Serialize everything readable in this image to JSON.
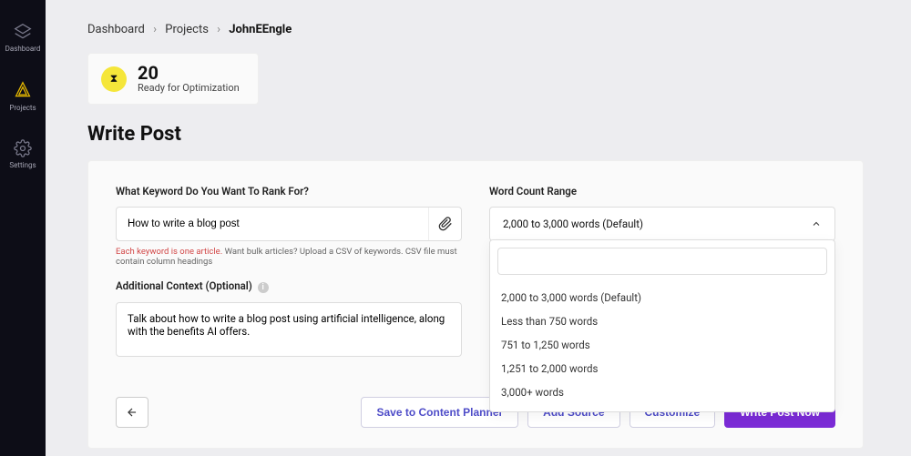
{
  "sidebar": {
    "items": [
      {
        "label": "Dashboard"
      },
      {
        "label": "Projects"
      },
      {
        "label": "Settings"
      }
    ]
  },
  "breadcrumb": {
    "a": "Dashboard",
    "b": "Projects",
    "c": "JohnEEngle"
  },
  "ready": {
    "count": "20",
    "sub": "Ready for Optimization"
  },
  "page_title": "Write Post",
  "keyword": {
    "label": "What Keyword Do You Want To Rank For?",
    "value": "How to write a blog post",
    "helper_warn": "Each keyword is one article.",
    "helper_rest": " Want bulk articles? Upload a CSV of keywords. CSV file must contain column headings"
  },
  "context": {
    "label": "Additional Context (Optional)",
    "value": "Talk about how to write a blog post using artificial intelligence, along with the benefits AI offers."
  },
  "wordcount": {
    "label": "Word Count Range",
    "selected": "2,000 to 3,000 words (Default)",
    "options": [
      "2,000 to 3,000 words (Default)",
      "Less than 750 words",
      "751 to 1,250 words",
      "1,251 to 2,000 words",
      "3,000+ words"
    ]
  },
  "buttons": {
    "save": "Save to Content Planner",
    "add_source": "Add Source",
    "customize": "Customize",
    "write": "Write Post Now"
  }
}
